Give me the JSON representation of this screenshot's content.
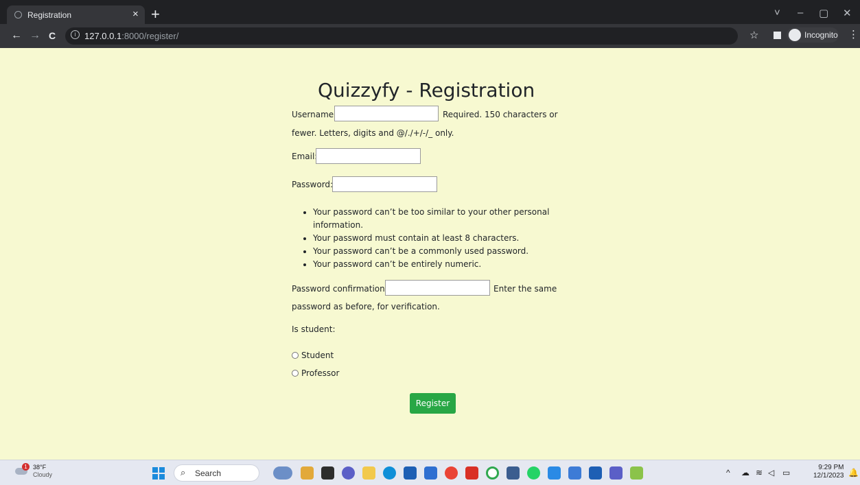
{
  "browser": {
    "tab_title": "Registration",
    "tab_close": "×",
    "new_tab": "+",
    "url_host": "127.0.0.1",
    "url_rest": ":8000/register/",
    "incognito_label": "Incognito",
    "nav_back": "←",
    "nav_forward": "→",
    "nav_reload": "C",
    "info_icon": "i",
    "star": "☆",
    "menu": "⋮",
    "window_controls": [
      "˅",
      "–",
      "▢",
      "✕"
    ]
  },
  "page": {
    "title": "Quizzyfy - Registration",
    "username_label": "Username:",
    "username_help_line1": "Required. 150 characters or",
    "username_help_line2": "fewer. Letters, digits and @/./+/-/_ only.",
    "email_label": "Email:",
    "password_label": "Password:",
    "password_rules": [
      "Your password can’t be too similar to your other personal information.",
      "Your password must contain at least 8 characters.",
      "Your password can’t be a commonly used password.",
      "Your password can’t be entirely numeric."
    ],
    "password2_label": "Password confirmation:",
    "password2_help_line1": "Enter the same",
    "password2_help_line2": "password as before, for verification.",
    "is_student_label": "Is student:",
    "radio_options": [
      "Student",
      "Professor"
    ],
    "submit_label": "Register"
  },
  "taskbar": {
    "weather_temp": "38°F",
    "weather_condition": "Cloudy",
    "weather_badge": "1",
    "search_label": "Search",
    "time": "9:29 PM",
    "date": "12/1/2023",
    "accent_color": "#1b8bdc"
  }
}
